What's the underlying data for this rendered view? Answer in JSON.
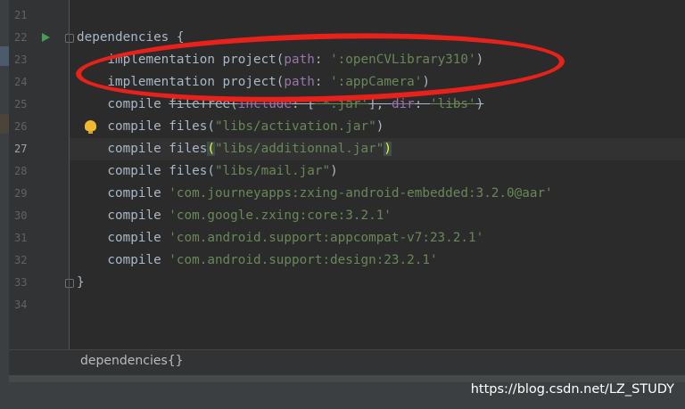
{
  "editor": {
    "theme_colors": {
      "background": "#2b2b2b",
      "keyword": "#cc7832",
      "string": "#6a8759",
      "parameter": "#9876aa",
      "default": "#a9b7c6",
      "annotation": "#e8221b"
    },
    "current_line": "27",
    "lines": [
      {
        "num": "21",
        "tokens": []
      },
      {
        "num": "22",
        "tokens": [
          {
            "t": "dependencies {",
            "c": "default"
          }
        ],
        "run_icon": true,
        "fold_icon": true
      },
      {
        "num": "23",
        "tokens": [
          {
            "t": "    implementation project(",
            "c": "default"
          },
          {
            "t": "path",
            "c": "param"
          },
          {
            "t": ": ",
            "c": "default"
          },
          {
            "t": "':openCVLibrary310'",
            "c": "str"
          },
          {
            "t": ")",
            "c": "default"
          }
        ]
      },
      {
        "num": "24",
        "tokens": [
          {
            "t": "    implementation project(",
            "c": "default"
          },
          {
            "t": "path",
            "c": "param"
          },
          {
            "t": ": ",
            "c": "default"
          },
          {
            "t": "':appCamera'",
            "c": "str"
          },
          {
            "t": ")",
            "c": "default"
          }
        ]
      },
      {
        "num": "25",
        "tokens": [
          {
            "t": "    compile ",
            "c": "default"
          },
          {
            "t": "fileTree(",
            "c": "strike"
          },
          {
            "t": "include",
            "c": "param-strike"
          },
          {
            "t": ": [",
            "c": "strike"
          },
          {
            "t": "'*.jar'",
            "c": "str-strike"
          },
          {
            "t": "], ",
            "c": "strike"
          },
          {
            "t": "dir",
            "c": "param-strike"
          },
          {
            "t": ": ",
            "c": "strike"
          },
          {
            "t": "'libs'",
            "c": "str-strike"
          },
          {
            "t": ")",
            "c": "strike"
          }
        ]
      },
      {
        "num": "26",
        "tokens": [
          {
            "t": "    compile files(",
            "c": "default"
          },
          {
            "t": "\"libs/activation.jar\"",
            "c": "str"
          },
          {
            "t": ")",
            "c": "default"
          }
        ],
        "bulb_icon": true
      },
      {
        "num": "27",
        "tokens": [
          {
            "t": "    compile files",
            "c": "default"
          },
          {
            "t": "(",
            "c": "brace"
          },
          {
            "t": "\"libs/additionnal.jar\"",
            "c": "str"
          },
          {
            "t": ")",
            "c": "brace"
          }
        ]
      },
      {
        "num": "28",
        "tokens": [
          {
            "t": "    compile files(",
            "c": "default"
          },
          {
            "t": "\"libs/mail.jar\"",
            "c": "str"
          },
          {
            "t": ")",
            "c": "default"
          }
        ]
      },
      {
        "num": "29",
        "tokens": [
          {
            "t": "    compile ",
            "c": "default"
          },
          {
            "t": "'com.journeyapps:zxing-android-embedded:3.2.0@aar'",
            "c": "str"
          }
        ]
      },
      {
        "num": "30",
        "tokens": [
          {
            "t": "    compile ",
            "c": "default"
          },
          {
            "t": "'com.google.zxing:core:3.2.1'",
            "c": "str"
          }
        ]
      },
      {
        "num": "31",
        "tokens": [
          {
            "t": "    compile ",
            "c": "default"
          },
          {
            "t": "'com.android.support:appcompat-v7:23.2.1'",
            "c": "str"
          }
        ]
      },
      {
        "num": "32",
        "tokens": [
          {
            "t": "    compile ",
            "c": "default"
          },
          {
            "t": "'com.android.support:design:23.2.1'",
            "c": "str"
          }
        ]
      },
      {
        "num": "33",
        "tokens": [
          {
            "t": "}",
            "c": "default"
          }
        ],
        "fold_icon": true
      },
      {
        "num": "34",
        "tokens": []
      }
    ]
  },
  "breadcrumb": {
    "label": "dependencies{}"
  },
  "watermark": {
    "text": "https://blog.csdn.net/LZ_STUDY"
  }
}
